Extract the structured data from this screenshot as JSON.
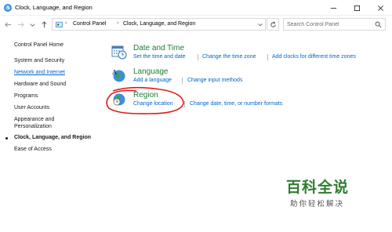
{
  "window": {
    "title": "Clock, Language, and Region"
  },
  "address": {
    "crumbs": [
      "Control Panel",
      "Clock, Language, and Region"
    ],
    "search_placeholder": "Search Control Panel"
  },
  "sidebar": {
    "items": [
      {
        "label": "Control Panel Home"
      },
      {
        "label": "System and Security"
      },
      {
        "label": "Network and Internet"
      },
      {
        "label": "Hardware and Sound"
      },
      {
        "label": "Programs"
      },
      {
        "label": "User Accounts"
      },
      {
        "label": "Appearance and"
      },
      {
        "label": "Personalization"
      },
      {
        "label": "Clock, Language, and Region"
      },
      {
        "label": "Ease of Access"
      }
    ]
  },
  "categories": {
    "datetime": {
      "title": "Date and Time",
      "links": [
        "Set the time and date",
        "Change the time zone",
        "Add clocks for different time zones"
      ]
    },
    "language": {
      "title": "Language",
      "links": [
        "Add a language",
        "Change input methods"
      ]
    },
    "region": {
      "title": "Region",
      "links": [
        "Change location",
        "Change date, time, or number formats"
      ]
    }
  },
  "watermark": {
    "main": "百科全说",
    "sub": "助你轻松解决"
  },
  "colors": {
    "link": "#0066cc",
    "category_title": "#1e7d3a",
    "annotation": "#e01b1b",
    "watermark": "#2e7d32"
  }
}
